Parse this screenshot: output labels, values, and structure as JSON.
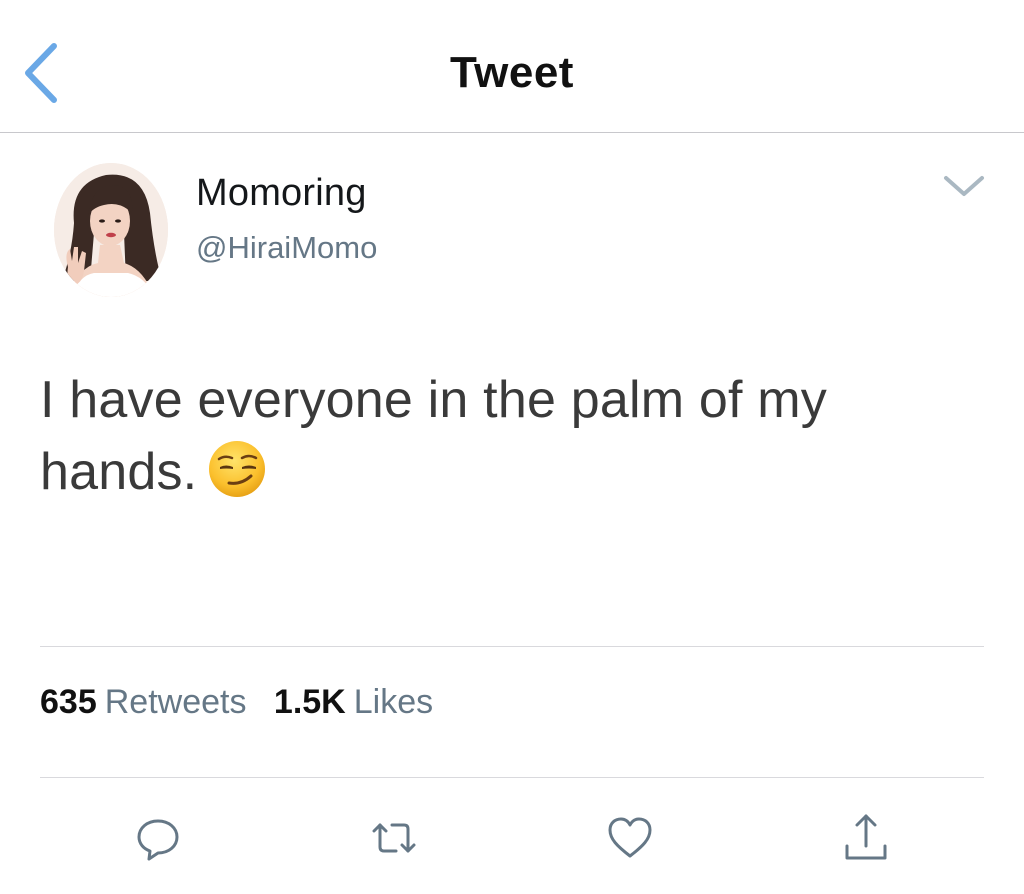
{
  "nav": {
    "title": "Tweet",
    "back_icon": "chevron-left-icon",
    "accent": "#6aa8e6"
  },
  "tweet": {
    "author": {
      "display_name": "Momoring",
      "handle": "@HiraiMomo"
    },
    "text": "I have everyone in the palm of my hands.",
    "emoji": "smirking-face-emoji"
  },
  "stats": {
    "retweets_count": "635",
    "retweets_label": "Retweets",
    "likes_count": "1.5K",
    "likes_label": "Likes"
  },
  "actions": [
    {
      "icon": "reply-icon"
    },
    {
      "icon": "retweet-icon"
    },
    {
      "icon": "like-icon"
    },
    {
      "icon": "share-icon"
    }
  ],
  "colors": {
    "secondary_text": "#657786",
    "icon_gray": "#657786"
  }
}
